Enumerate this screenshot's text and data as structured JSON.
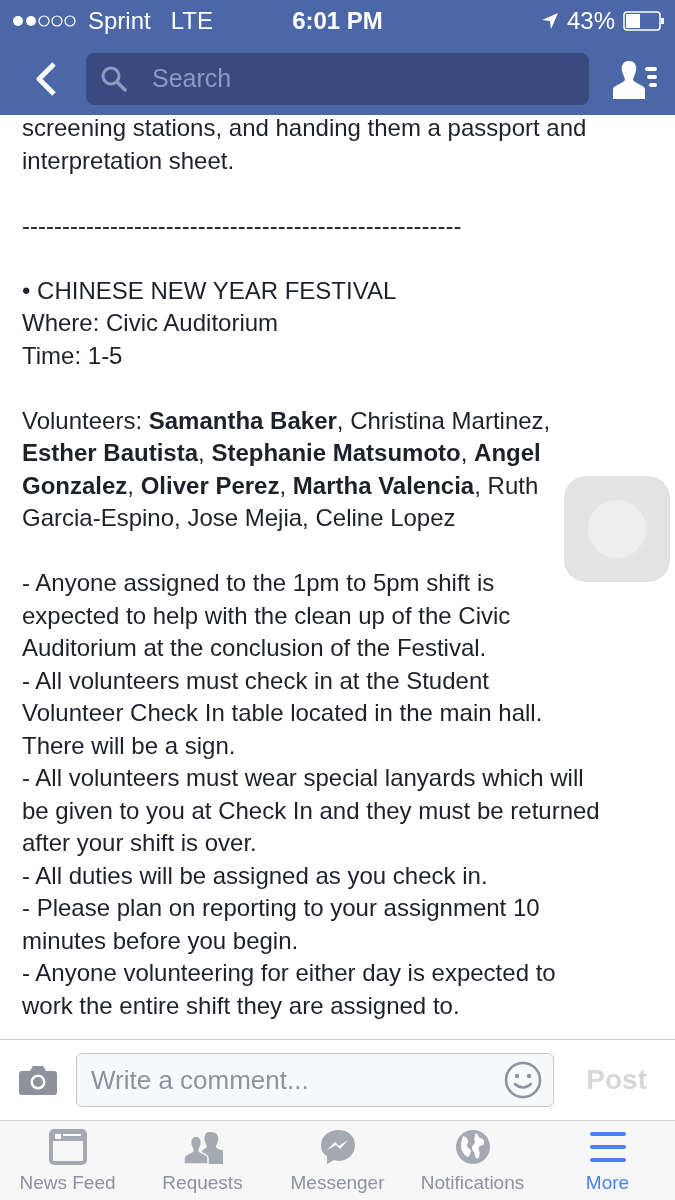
{
  "status_bar": {
    "carrier": "Sprint",
    "network": "LTE",
    "time": "6:01 PM",
    "battery": "43%"
  },
  "nav": {
    "search": {
      "placeholder": "Search"
    }
  },
  "post_blocks": [
    {
      "lines": [
        "screening stations, and handing them a passport and",
        "interpretation sheet."
      ]
    },
    {
      "lines": [
        "-------------------------------------------------------"
      ]
    },
    {
      "lines": [
        "• CHINESE NEW YEAR FESTIVAL",
        "Where: Civic Auditorium",
        "Time: 1-5"
      ]
    },
    {
      "lines": [
        "Volunteers: **Samantha Baker**, Christina Martinez,",
        "**Esther Bautista**, **Stephanie Matsumoto**, **Angel**",
        "**Gonzalez**, **Oliver Perez**, **Martha Valencia**, Ruth",
        "Garcia-Espino, Jose Mejia, Celine Lopez"
      ]
    },
    {
      "lines": [
        "- Anyone assigned to the 1pm to 5pm shift is",
        "expected to help with the clean up of the Civic",
        "Auditorium at the conclusion of the Festival.",
        "- All volunteers must check in at the Student",
        "Volunteer Check In table located in the main hall.",
        "There will be a sign.",
        "- All volunteers must wear special lanyards which will",
        "be given to you at Check In and they must be returned",
        "after your shift is over.",
        "- All duties will be assigned as you check in.",
        "- Please plan on reporting to your assignment 10",
        "minutes before you begin.",
        "- Anyone volunteering for either day is expected to",
        "work the entire shift they are assigned to."
      ]
    }
  ],
  "comment_bar": {
    "placeholder": "Write a comment...",
    "post_button": {
      "label": "Post",
      "disabled": true
    }
  },
  "tabs": [
    {
      "label": "News Feed",
      "kind": "feed",
      "selected": false
    },
    {
      "label": "Requests",
      "kind": "requests",
      "selected": false
    },
    {
      "label": "Messenger",
      "kind": "messenger",
      "selected": false
    },
    {
      "label": "Notifications",
      "kind": "globe",
      "selected": false
    },
    {
      "label": "More",
      "kind": "menu",
      "selected": true
    }
  ]
}
